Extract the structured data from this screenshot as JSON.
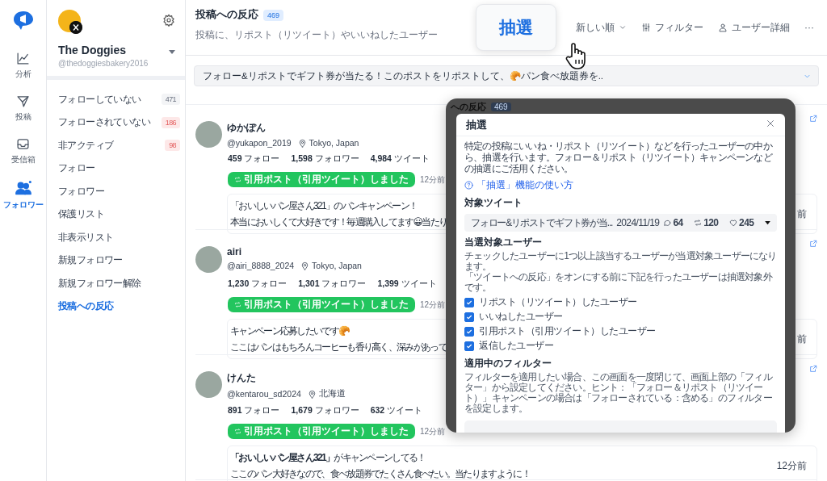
{
  "rail": {
    "items": [
      {
        "label": "分析",
        "kind": "chart",
        "selected": false
      },
      {
        "label": "投稿",
        "kind": "send",
        "selected": false
      },
      {
        "label": "受信箱",
        "kind": "inbox",
        "selected": false
      },
      {
        "label": "フォロワー",
        "kind": "people",
        "selected": true
      }
    ]
  },
  "account": {
    "name": "The Doggies",
    "handle": "@thedoggiesbakery2016"
  },
  "nav": {
    "items": [
      {
        "label": "フォローしていない",
        "badge": "471",
        "alert": false,
        "selected": false
      },
      {
        "label": "フォローされていない",
        "badge": "186",
        "alert": true,
        "selected": false
      },
      {
        "label": "非アクティブ",
        "badge": "98",
        "alert": true,
        "selected": false
      },
      {
        "label": "フォロー",
        "selected": false
      },
      {
        "label": "フォロワー",
        "selected": false
      },
      {
        "label": "保護リスト",
        "selected": false
      },
      {
        "label": "非表示リスト",
        "selected": false
      },
      {
        "label": "新規フォロワー",
        "selected": false
      },
      {
        "label": "新規フォロワー解除",
        "selected": false
      },
      {
        "label": "投稿への反応",
        "selected": true
      }
    ]
  },
  "header": {
    "title": "投稿への反応",
    "count": "469",
    "subtitle": "投稿に、リポスト（リツイート）やいいねしたユーザー",
    "draw_button": "抽選",
    "sort": "新しい順",
    "filter": "フィルター",
    "user_detail": "ユーザー詳細",
    "more": "···"
  },
  "tweet_selector": {
    "text": "フォロー&リポストでギフト券が当たる！このポストをリポストして、🥐パン食べ放題券を.."
  },
  "users": [
    {
      "name": "ゆかぽん",
      "handle": "@yukapon_2019",
      "location": "Tokyo, Japan",
      "stats": [
        "**459** フォロー",
        "**1,598** フォロワー",
        "**4,984** ツイート"
      ],
      "tag": "引用ポスト（引用ツイート）しました",
      "time": "12分前",
      "post": [
        "「おいしいパン屋さん321」のパンキャンペーン！",
        "本当においしくて大好きです！毎週購入してます😀当たり"
      ],
      "post_time": "前"
    },
    {
      "name": "airi",
      "handle": "@airi_8888_2024",
      "location": "Tokyo, Japan",
      "stats": [
        "**1,230** フォロー",
        "**1,301** フォロワー",
        "**1,399** ツイート"
      ],
      "tag": "引用ポスト（引用ツイート）しました",
      "time": "12分前",
      "post": [
        "キャンペーン応募したいです🥐",
        "ここはパンはもちろんコーヒーも香り高く、深みがあって"
      ],
      "post_time": "前"
    },
    {
      "name": "けんた",
      "handle": "@kentarou_sd2024",
      "location": "北海道",
      "stats": [
        "**891** フォロー",
        "**1,679** フォロワー",
        "**632** ツイート"
      ],
      "tag": "引用ポスト（引用ツイート）しました",
      "time": "12分前",
      "post": [
        "**「おいしいパン屋さん321」**がキャンペーンしてる！",
        "ここのパン大好きなので、食べ放題券でたくさん食べたい。当たりますように！"
      ],
      "post_time": "12分前"
    }
  ],
  "overlay": {
    "backdrop_title": "への反応",
    "backdrop_count": "469",
    "modal": {
      "title": "抽選",
      "description": "特定の投稿にいいね・リポスト（リツイート）などを行ったユーザーの中から、抽選を行います。フォロー＆リポスト（リツイート）キャンペーンなどの抽選にご活用ください。",
      "help_link": "「抽選」機能の使い方",
      "target_label": "対象ツイート",
      "tweet": {
        "text": "フォロー&リポストでギフト券が当...",
        "date": "2024/11/19",
        "replies": "64",
        "retweets": "120",
        "likes": "245"
      },
      "winners_label": "当選対象ユーザー",
      "winners_note": [
        "チェックしたユーザーに1つ以上該当するユーザーが当選対象ユーザーになります。",
        "「ツイートへの反応」をオンにする前に下記を行ったユーザーは抽選対象外です。"
      ],
      "checkboxes": [
        {
          "label": "リポスト（リツイート）したユーザー",
          "checked": true
        },
        {
          "label": "いいねしたユーザー",
          "checked": true
        },
        {
          "label": "引用ポスト（引用ツイート）したユーザー",
          "checked": true
        },
        {
          "label": "返信したユーザー",
          "checked": true
        }
      ],
      "filter_label": "適用中のフィルター",
      "filter_note": "フィルターを適用したい場合、この画面を一度閉じて、画面上部の「フィルター」から設定してください。ヒント：「フォロー＆リポスト（リツイート）」キャンペーンの場合は「フォローされている：含める」のフィルターを設定します。"
    }
  }
}
